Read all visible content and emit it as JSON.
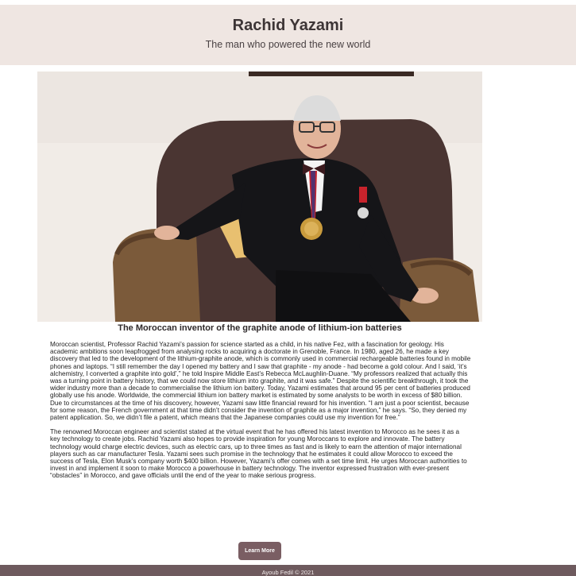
{
  "header": {
    "title": "Rachid Yazami",
    "subtitle": "The man who powered the new world"
  },
  "hero_image": {
    "subject": "portrait-photo"
  },
  "caption": "The Moroccan inventor of the graphite anode of lithium-ion batteries",
  "article": {
    "paragraphs": [
      "Moroccan scientist, Professor Rachid Yazami’s passion for science started as a child, in his native Fez, with a fascination for geology. His academic ambitions soon leapfrogged from analysing rocks to acquiring a doctorate in Grenoble, France. In 1980, aged 26, he made a key discovery that led to the development of the lithium-graphite anode, which is commonly used in commercial rechargeable batteries found in mobile phones and laptops. “I still remember the day I opened my battery and I saw that graphite - my anode - had become a gold colour. And I said, ‘it’s alchemistry, I converted a graphite into gold’,” he told Inspire Middle East’s Rebecca McLaughlin-Duane. “My professors realized that actually this was a turning point in battery history, that we could now store lithium into graphite, and it was safe.” Despite the scientific breakthrough, it took the wider industry more than a decade to commercialise the lithium ion battery. Today, Yazami estimates that around 95 per cent of batteries produced globally use his anode. Worldwide, the commercial lithium ion battery market is estimated by some analysts to be worth in excess of $80 billion. Due to circumstances at the time of his discovery, however, Yazami saw little financial reward for his invention. “I am just a poor scientist, because for some reason, the French government at that time didn’t consider the invention of graphite as a major invention,” he says. “So, they denied my patent application. So, we didn’t file a patent, which means that the Japanese companies could use my invention for free.”",
      "The renowned Moroccan engineer and scientist stated at the virtual event that he has offered his latest invention to Morocco as he sees it as a key technology to create jobs. Rachid Yazami also hopes to provide inspiration for young Moroccans to explore and innovate. The battery technology would charge electric devices, such as electric cars, up to three times as fast and is likely to earn the attention of major international players such as car manufacturer Tesla. Yazami sees such promise in the technology that he estimates it could allow Morocco to exceed the success of Tesla, Elon Musk’s company worth $400 billion. However, Yazami’s offer comes with a set time limit. He urges Moroccan authorities to invest in and implement it soon to make Morocco a powerhouse in battery technology. The inventor expressed frustration with ever-present “obstacles” in Morocco, and gave officials until the end of the year to make serious progress."
    ]
  },
  "cta": {
    "label": "Learn More"
  },
  "footer": {
    "text": "Ayoub Fedil © 2021"
  },
  "colors": {
    "header_bg": "#efe6e2",
    "button_bg": "#7a5e63",
    "footer_bg": "#6e5a5e"
  }
}
